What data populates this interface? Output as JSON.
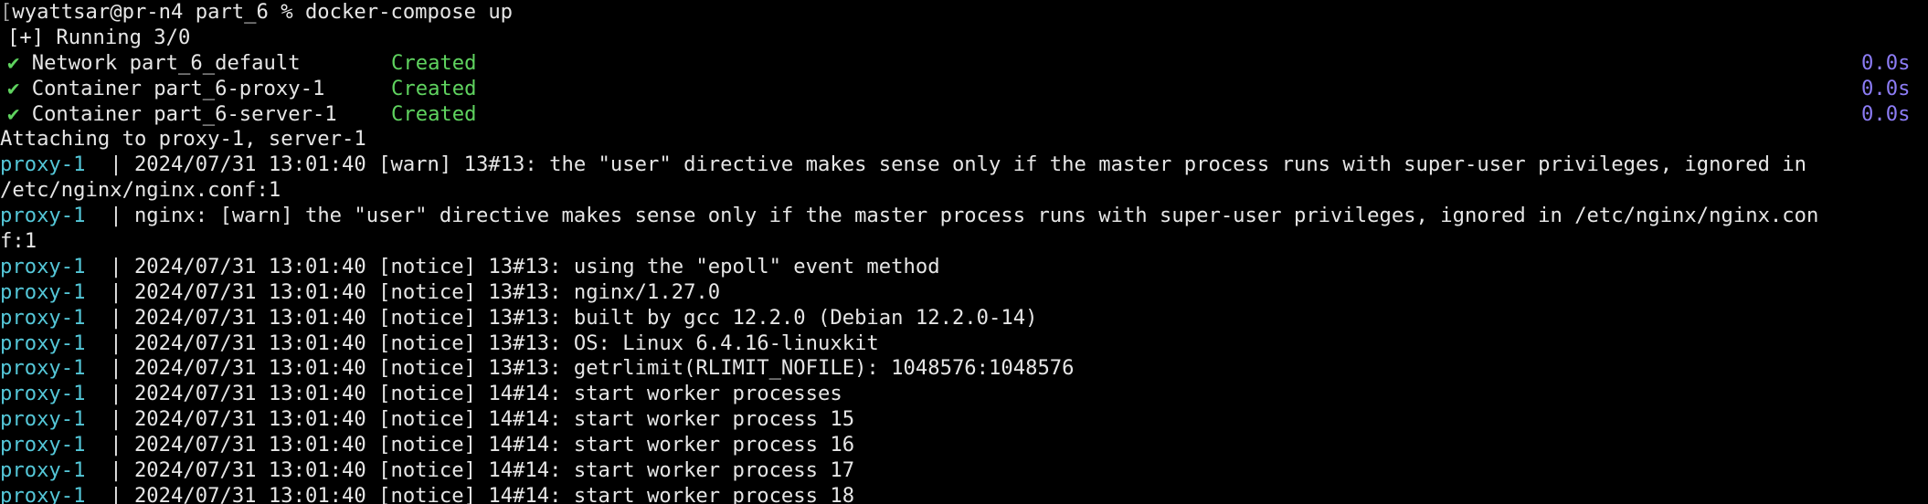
{
  "prompt": {
    "bracket": "[",
    "text": "wyattsar@pr-n4 part_6 % docker-compose up"
  },
  "running": "[+] Running 3/0",
  "resources": [
    {
      "check": "✔",
      "name": "Network part_6_default",
      "status": "Created",
      "time": "0.0s"
    },
    {
      "check": "✔",
      "name": "Container part_6-proxy-1",
      "status": "Created",
      "time": "0.0s"
    },
    {
      "check": "✔",
      "name": "Container part_6-server-1",
      "status": "Created",
      "time": "0.0s"
    }
  ],
  "attaching": "Attaching to proxy-1, server-1",
  "log_prefix": {
    "service": "proxy-1",
    "pipe": "  | "
  },
  "logs": [
    {
      "text": "2024/07/31 13:01:40 [warn] 13#13: the \"user\" directive makes sense only if the master process runs with super-user privileges, ignored in",
      "cont": "/etc/nginx/nginx.conf:1"
    },
    {
      "text": "nginx: [warn] the \"user\" directive makes sense only if the master process runs with super-user privileges, ignored in /etc/nginx/nginx.con",
      "cont": "f:1"
    },
    {
      "text": "2024/07/31 13:01:40 [notice] 13#13: using the \"epoll\" event method"
    },
    {
      "text": "2024/07/31 13:01:40 [notice] 13#13: nginx/1.27.0"
    },
    {
      "text": "2024/07/31 13:01:40 [notice] 13#13: built by gcc 12.2.0 (Debian 12.2.0-14)"
    },
    {
      "text": "2024/07/31 13:01:40 [notice] 13#13: OS: Linux 6.4.16-linuxkit"
    },
    {
      "text": "2024/07/31 13:01:40 [notice] 13#13: getrlimit(RLIMIT_NOFILE): 1048576:1048576"
    },
    {
      "text": "2024/07/31 13:01:40 [notice] 14#14: start worker processes"
    },
    {
      "text": "2024/07/31 13:01:40 [notice] 14#14: start worker process 15"
    },
    {
      "text": "2024/07/31 13:01:40 [notice] 14#14: start worker process 16"
    },
    {
      "text": "2024/07/31 13:01:40 [notice] 14#14: start worker process 17"
    },
    {
      "text": "2024/07/31 13:01:40 [notice] 14#14: start worker process 18"
    }
  ],
  "colors": {
    "background": "#000000",
    "text": "#e6e6e6",
    "status_green": "#5fd35f",
    "duration_purple": "#8c7cf5",
    "service_cyan": "#54c7d8"
  }
}
